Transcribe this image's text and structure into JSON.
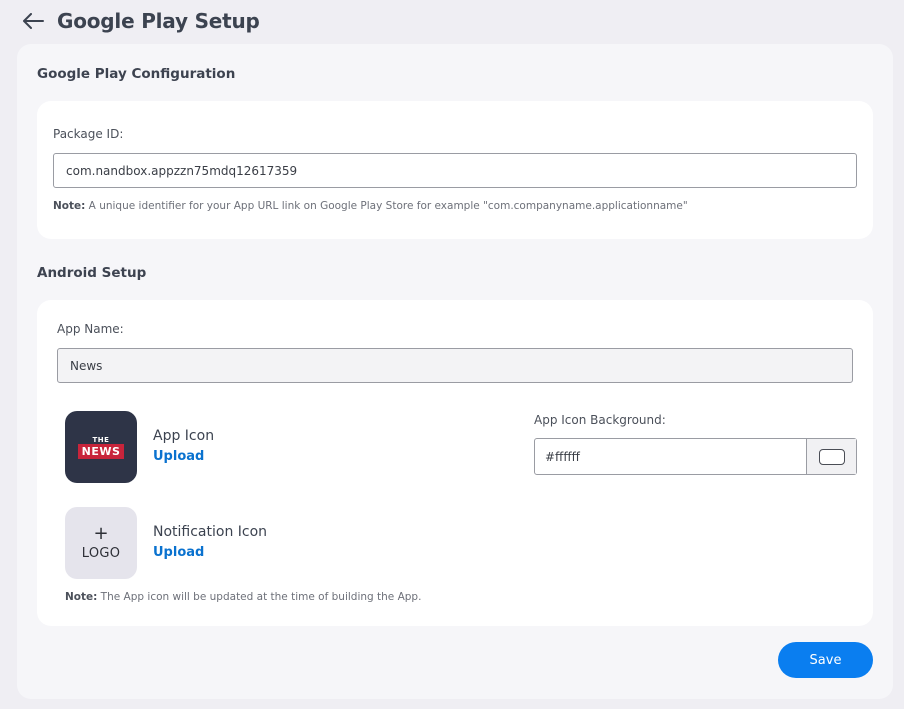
{
  "page": {
    "title": "Google Play Setup"
  },
  "google_play": {
    "section_title": "Google Play Configuration",
    "package_label": "Package ID:",
    "package_value": "com.nandbox.appzzn75mdq12617359",
    "note_label": "Note:",
    "note_text": " A unique identifier for your App URL link on Google Play Store for example \"com.companyname.applicationname\""
  },
  "android": {
    "section_title": "Android Setup",
    "app_name_label": "App Name:",
    "app_name_value": "News",
    "app_icon": {
      "title": "App Icon",
      "upload": "Upload",
      "image_top_text": "THE",
      "image_band_text": "NEWS"
    },
    "notification_icon": {
      "title": "Notification Icon",
      "upload": "Upload",
      "placeholder_plus": "+",
      "placeholder_text": "LOGO"
    },
    "bg_label": "App Icon Background:",
    "bg_value": "#ffffff",
    "note_label": "Note:",
    "note_text": " The App icon will be updated at the time of building the App."
  },
  "actions": {
    "save": "Save"
  },
  "colors": {
    "accent": "#0a7ef0",
    "link": "#0a72cf",
    "news_band": "#c8243b",
    "icon_bg": "#2e3447"
  },
  "icons": {
    "back": "arrow-left-icon"
  }
}
